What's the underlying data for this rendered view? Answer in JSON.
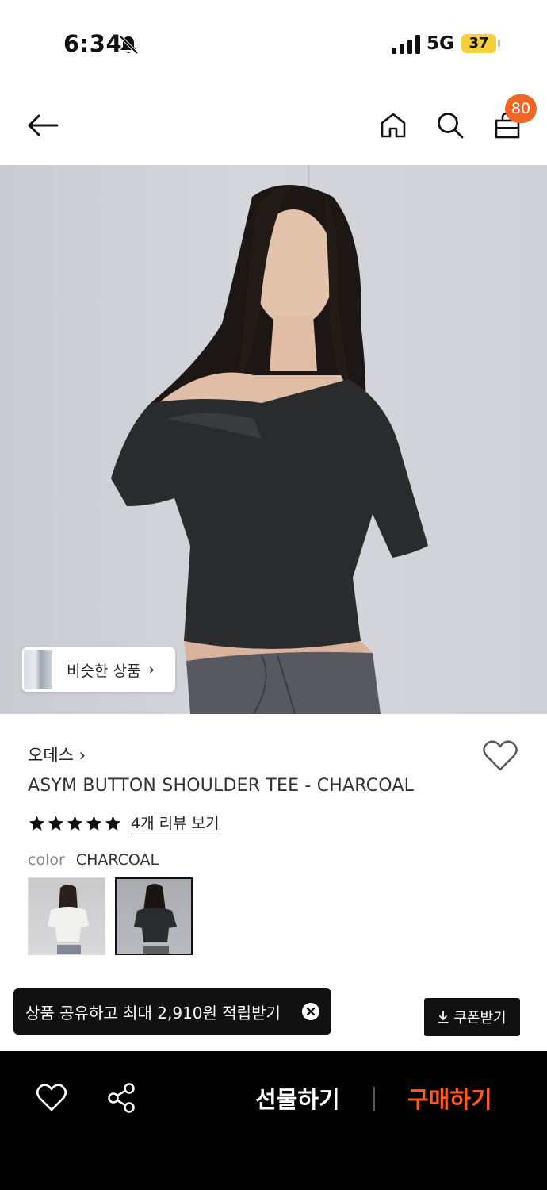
{
  "status_bar": {
    "time": "6:34",
    "network": "5G",
    "battery": "37"
  },
  "nav": {
    "cart_count": "80"
  },
  "hero": {
    "similar_label": "비슷한 상품"
  },
  "product": {
    "brand": "오데스 ›",
    "title": "ASYM BUTTON SHOULDER TEE - CHARCOAL",
    "rating": 5,
    "review_link": "4개 리뷰 보기",
    "color_label": "color",
    "color_value": "CHARCOAL",
    "swatches": [
      "white",
      "charcoal"
    ]
  },
  "toast": {
    "text": "상품 공유하고 최대 2,910원 적립받기"
  },
  "coupon": {
    "label": "쿠폰받기"
  },
  "bottom_bar": {
    "gift_label": "선물하기",
    "buy_label": "구매하기"
  },
  "colors": {
    "accent": "#f06424",
    "buy": "#ff5a1f",
    "bar_bg": "#000000"
  },
  "icons": [
    "bell-slash-icon",
    "signal-icon",
    "back-arrow-icon",
    "home-icon",
    "search-icon",
    "cart-icon",
    "heart-icon",
    "star-icon",
    "close-icon",
    "download-icon",
    "share-icon"
  ]
}
